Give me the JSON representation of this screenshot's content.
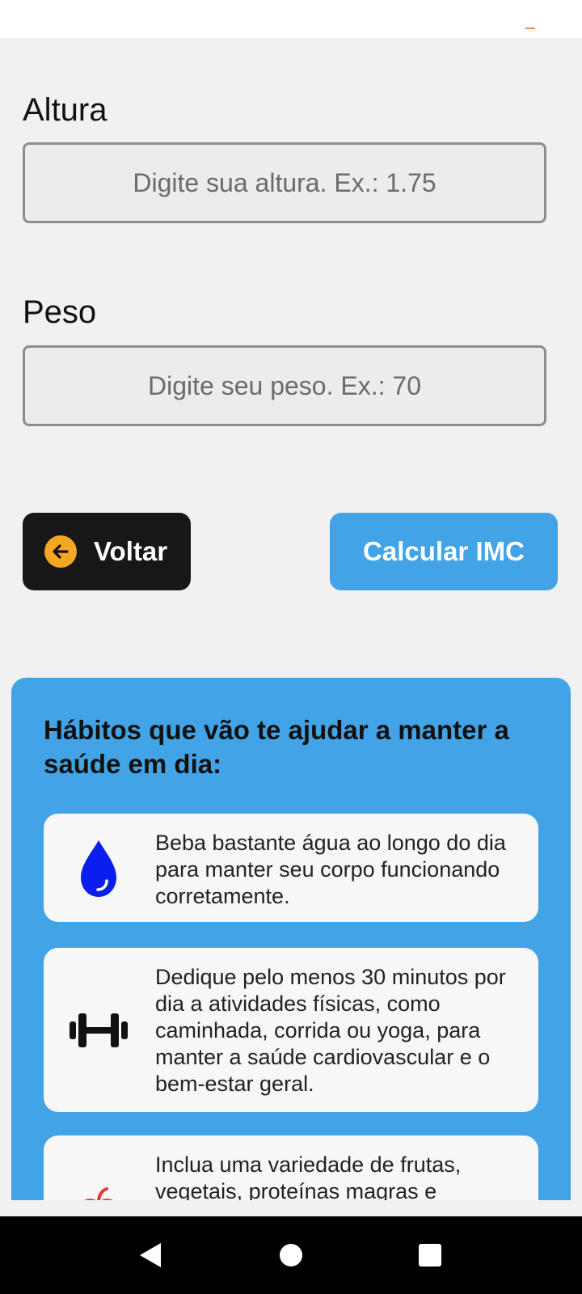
{
  "form": {
    "height_label": "Altura",
    "height_placeholder": "Digite sua altura. Ex.: 1.75",
    "height_value": "",
    "weight_label": "Peso",
    "weight_placeholder": "Digite seu peso. Ex.: 70",
    "weight_value": ""
  },
  "actions": {
    "back_label": "Voltar",
    "calculate_label": "Calcular IMC"
  },
  "habits": {
    "title": "Hábitos que vão te ajudar a manter a saúde em dia:",
    "items": [
      {
        "icon": "water-drop-icon",
        "text": "Beba bastante água ao longo do dia para manter seu corpo funcionando corretamente."
      },
      {
        "icon": "dumbbell-icon",
        "text": "Dedique pelo menos 30 minutos por dia a atividades físicas, como caminhada, corrida ou yoga, para manter a saúde cardiovascular e o bem-estar geral."
      },
      {
        "icon": "apple-icon",
        "text": "Inclua uma variedade de frutas, vegetais, proteínas magras e"
      }
    ]
  },
  "colors": {
    "panel": "#42a4e6",
    "primary_button": "#42a4e6",
    "back_button": "#171717",
    "back_icon": "#f5a623",
    "water_icon": "#0a1ef0",
    "apple_icon": "#e53935"
  },
  "navigation": {
    "back_icon": "triangle-back-icon",
    "home_icon": "circle-home-icon",
    "recents_icon": "square-recents-icon"
  }
}
